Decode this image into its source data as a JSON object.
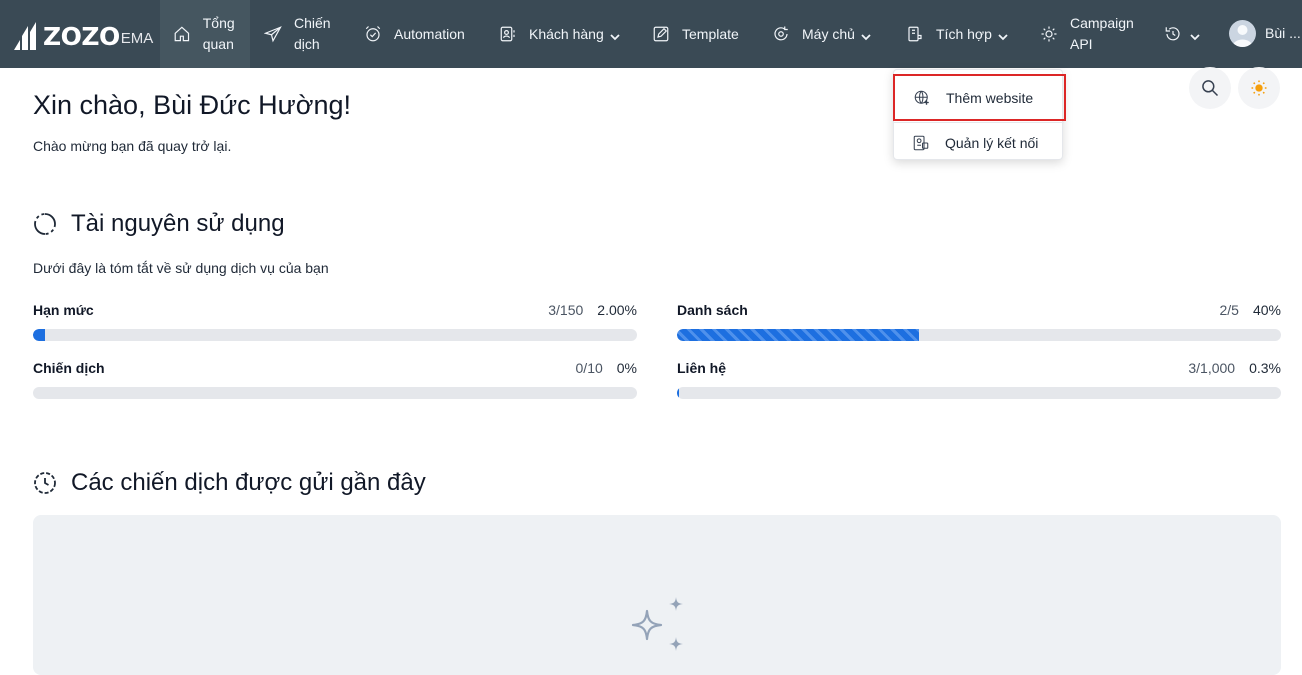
{
  "brand": {
    "logo_main": "ZOZO",
    "logo_sub": "EMA"
  },
  "nav": {
    "items": [
      {
        "label": "Tổng quan",
        "icon": "home-icon"
      },
      {
        "label": "Chiến dịch",
        "icon": "send-icon"
      },
      {
        "label": "Automation",
        "icon": "clock-check-icon"
      },
      {
        "label": "Khách hàng",
        "icon": "contacts-icon"
      },
      {
        "label": "Template",
        "icon": "edit-icon"
      },
      {
        "label": "Máy chủ",
        "icon": "server-sync-icon"
      },
      {
        "label": "Tích hợp",
        "icon": "plug-icon"
      },
      {
        "label": "Campaign API",
        "icon": "api-gear-icon"
      }
    ],
    "user_name": "Bùi ..."
  },
  "dropdown": {
    "items": [
      {
        "label": "Thêm website",
        "icon": "globe-plus-icon"
      },
      {
        "label": "Quản lý kết nối",
        "icon": "connection-icon"
      }
    ]
  },
  "header": {
    "greeting": "Xin chào, Bùi Đức Hường!",
    "welcome": "Chào mừng bạn đã quay trở lại."
  },
  "usage": {
    "title": "Tài nguyên sử dụng",
    "subtitle": "Dưới đây là tóm tắt về sử dụng dịch vụ của bạn",
    "metrics": [
      {
        "name": "Hạn mức",
        "used": "3/150",
        "percent": "2.00%",
        "fraction": 0.02
      },
      {
        "name": "Danh sách",
        "used": "2/5",
        "percent": "40%",
        "fraction": 0.4
      },
      {
        "name": "Chiến dịch",
        "used": "0/10",
        "percent": "0%",
        "fraction": 0.0
      },
      {
        "name": "Liên hệ",
        "used": "3/1,000",
        "percent": "0.3%",
        "fraction": 0.003
      }
    ]
  },
  "recent": {
    "title": "Các chiến dịch được gửi gần đây"
  },
  "colors": {
    "navbar": "#3a4a55",
    "accent": "#1d6fe0",
    "highlight": "#dc2626"
  }
}
